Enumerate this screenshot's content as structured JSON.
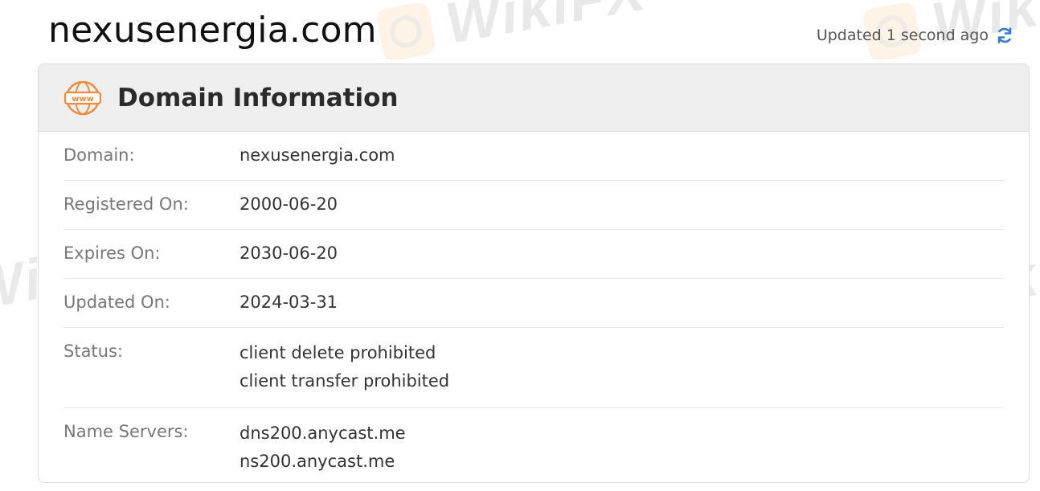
{
  "header": {
    "site_title": "nexusenergia.com",
    "updated_text": "Updated 1 second ago",
    "refresh_icon": "refresh-icon"
  },
  "watermark": {
    "text": "WikiFX"
  },
  "card": {
    "title": "Domain Information",
    "icon": "www-icon",
    "rows": [
      {
        "label": "Domain:",
        "values": [
          "nexusenergia.com"
        ]
      },
      {
        "label": "Registered On:",
        "values": [
          "2000-06-20"
        ]
      },
      {
        "label": "Expires On:",
        "values": [
          "2030-06-20"
        ]
      },
      {
        "label": "Updated On:",
        "values": [
          "2024-03-31"
        ]
      },
      {
        "label": "Status:",
        "values": [
          "client delete prohibited",
          "client transfer prohibited"
        ]
      },
      {
        "label": "Name Servers:",
        "values": [
          "dns200.anycast.me",
          "ns200.anycast.me"
        ]
      }
    ]
  },
  "colors": {
    "accent_orange": "#f08a3c",
    "refresh_blue": "#3a7bd5"
  }
}
